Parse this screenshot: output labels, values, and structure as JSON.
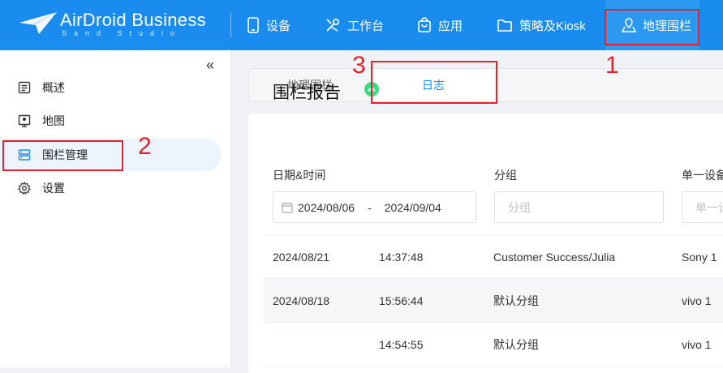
{
  "logo": {
    "main": "AirDroid Business",
    "sub": "Sand Studio"
  },
  "nav": [
    {
      "label": "设备",
      "icon": "phone-icon"
    },
    {
      "label": "工作台",
      "icon": "tools-icon"
    },
    {
      "label": "应用",
      "icon": "bag-icon"
    },
    {
      "label": "策略及Kiosk",
      "icon": "folder-icon"
    },
    {
      "label": "地理围栏",
      "icon": "geofence-icon",
      "active": true
    }
  ],
  "sidebar": {
    "collapse": "«",
    "items": [
      {
        "label": "概述",
        "icon": "overview-icon"
      },
      {
        "label": "地图",
        "icon": "map-icon"
      },
      {
        "label": "围栏管理",
        "icon": "fence-manage-icon",
        "active": true
      },
      {
        "label": "设置",
        "icon": "gear-icon"
      }
    ]
  },
  "tabs": [
    {
      "label": "地理围栏"
    },
    {
      "label": "日志",
      "active": true
    }
  ],
  "report": {
    "title": "围栏报告",
    "filters": {
      "datetime_label": "日期&时间",
      "date_start": "2024/08/06",
      "date_sep": "-",
      "date_end": "2024/09/04",
      "group_label": "分组",
      "group_placeholder": "分组",
      "device_label": "单一设备",
      "device_placeholder": "单一设"
    },
    "rows": [
      {
        "date": "2024/08/21",
        "time": "14:37:48",
        "group": "Customer Success/Julia",
        "device": "Sony 1"
      },
      {
        "date": "2024/08/18",
        "time": "15:56:44",
        "group": "默认分组",
        "device": "vivo 1"
      },
      {
        "date": "",
        "time": "14:54:55",
        "group": "默认分组",
        "device": "vivo 1"
      }
    ]
  },
  "annotations": [
    "1",
    "2",
    "3"
  ],
  "colors": {
    "primary": "#1a8cf0",
    "annotation": "#e3222b",
    "android": "#3ddc84"
  }
}
